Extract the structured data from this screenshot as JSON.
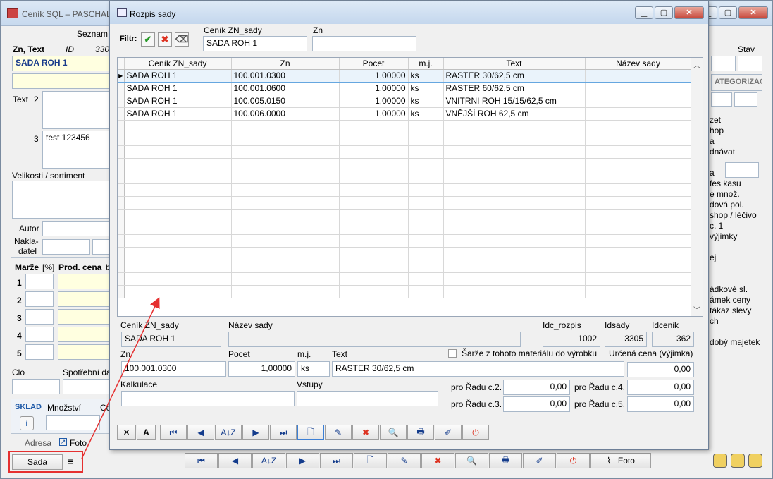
{
  "main": {
    "title": "Ceník SQL – PASCHAL",
    "menu_seznam": "Seznam",
    "zn_text_label": "Zn, Text",
    "id_label": "ID",
    "id_value": "330",
    "stav_label": "Stav",
    "name_value": "SADA ROH 1",
    "text_label": "Text",
    "text_2_label": "2",
    "text_3_label": "3",
    "text_3_value": "test 123456",
    "velikosti_label": "Velikosti / sortiment",
    "autor_label": "Autor",
    "nakladatel_label_1": "Nakla-",
    "nakladatel_label_2": "datel",
    "marze_label": "Marže",
    "percent_label": "[%]",
    "prod_cena_label": "Prod. cena",
    "b_label": "b",
    "rows": [
      "1",
      "2",
      "3",
      "4",
      "5"
    ],
    "clo_label": "Clo",
    "spotrebni_label": "Spotřební da",
    "sklad_label": "SKLAD",
    "mnozstvi_label": "Množství",
    "ce_label": "Ce",
    "info_icon": "i",
    "adresa_label": "Adresa",
    "foto_tab_label": "Foto",
    "kategorizace_label": "ATEGORIZACE",
    "right_items": [
      "zet",
      "hop",
      "a",
      "dnávat",
      "a",
      "fes kasu",
      "e množ.",
      "dová pol.",
      "shop / léčivo",
      "c. 1",
      "výjimky",
      "ej",
      "ádkové sl.",
      "ámek ceny",
      "tákaz slevy",
      "ch",
      "dobý majetek"
    ],
    "sada_button": "Sada",
    "burger_icon": "≡",
    "foto_button": "Foto",
    "nav_icons": [
      "⏮",
      "◀",
      "A↓Z",
      "▶",
      "⏭",
      "🗋",
      "✎",
      "✖",
      "🔍",
      "🖶",
      "✐",
      "⏻"
    ]
  },
  "dialog": {
    "title": "Rozpis sady",
    "filtr_label": "Filtr:",
    "filter_check": "✔",
    "filter_cross": "✖",
    "filter_eraser": "⌫",
    "cenik_label": "Ceník ZN_sady",
    "cenik_value": "SADA ROH 1",
    "zn_label": "Zn",
    "zn_value": "",
    "columns": [
      "Ceník ZN_sady",
      "Zn",
      "Pocet",
      "m.j.",
      "Text",
      "Název sady"
    ],
    "rows": [
      [
        "SADA ROH 1",
        "100.001.0300",
        "1,00000",
        "ks",
        "RASTER 30/62,5 cm",
        ""
      ],
      [
        "SADA ROH 1",
        "100.001.0600",
        "1,00000",
        "ks",
        "RASTER 60/62,5 cm",
        ""
      ],
      [
        "SADA ROH 1",
        "100.005.0150",
        "1,00000",
        "ks",
        "VNITRNI ROH 15/15/62,5 cm",
        ""
      ],
      [
        "SADA ROH 1",
        "100.006.0000",
        "1,00000",
        "ks",
        "VNĚJŠÍ ROH 62,5 cm",
        ""
      ]
    ],
    "scroll_up": "︿",
    "scroll_down": "﹀",
    "detail": {
      "cenik_label": "Ceník ZN_sady",
      "cenik_value": "SADA ROH 1",
      "nazev_label": "Název sady",
      "nazev_value": "",
      "idc_rozpis_label": "Idc_rozpis",
      "idc_rozpis_value": "1002",
      "idsady_label": "Idsady",
      "idsady_value": "3305",
      "idcenik_label": "Idcenik",
      "idcenik_value": "362",
      "zn_label": "Zn",
      "zn_value": "100.001.0300",
      "pocet_label": "Pocet",
      "pocet_value": "1,00000",
      "mj_label": "m.j.",
      "mj_value": "ks",
      "text_label": "Text",
      "text_value": "RASTER 30/62,5 cm",
      "sarze_label": "Šarže z tohoto materiálu do výrobku",
      "urcena_label": "Určená cena (výjimka)",
      "urcena_value": "0,00",
      "kalkulace_label": "Kalkulace",
      "vstupy_label": "Vstupy",
      "radu_c2_label": "pro Řadu c.2.",
      "radu_c2_value": "0,00",
      "radu_c3_label": "pro Řadu c.3.",
      "radu_c3_value": "0,00",
      "radu_c4_label": "pro Řadu c.4.",
      "radu_c4_value": "0,00",
      "radu_c5_label": "pro Řadu c.5.",
      "radu_c5_value": "0,00"
    },
    "toolbar_icons": [
      "✕",
      "A",
      "⏮",
      "◀",
      "A↓Z",
      "▶",
      "⏭",
      "🗋",
      "✎",
      "✖",
      "🔍",
      "🖶",
      "✐",
      "⏻"
    ]
  }
}
